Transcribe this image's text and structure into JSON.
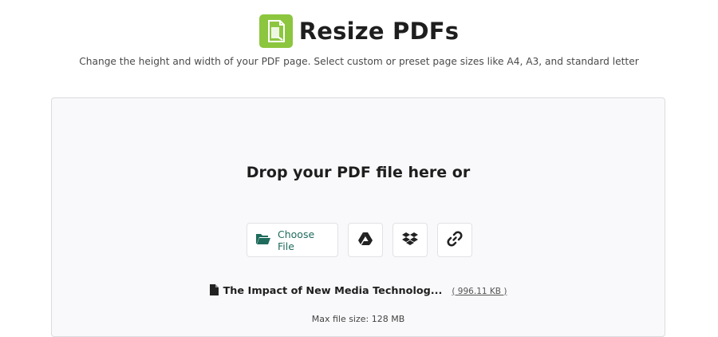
{
  "header": {
    "title": "Resize PDFs",
    "logo_icon": "resize-pdf-logo-icon",
    "logo_color": "#8cc63f"
  },
  "subtitle": "Change the height and width of your PDF page. Select custom or preset page sizes like A4, A3, and standard letter",
  "dropzone": {
    "prompt": "Drop your PDF file here or",
    "buttons": {
      "choose_file_label": "Choose File",
      "choose_file_icon": "folder-open-icon",
      "google_drive_icon": "google-drive-icon",
      "dropbox_icon": "dropbox-icon",
      "link_icon": "link-icon"
    },
    "file": {
      "name": "The Impact of New Media Technolog...",
      "size": "( 996.11 KB )",
      "icon": "file-icon"
    },
    "max_size_text": "Max file size: 128 MB"
  },
  "colors": {
    "accent": "#1f6b5c",
    "background": "#f9f9fb"
  }
}
